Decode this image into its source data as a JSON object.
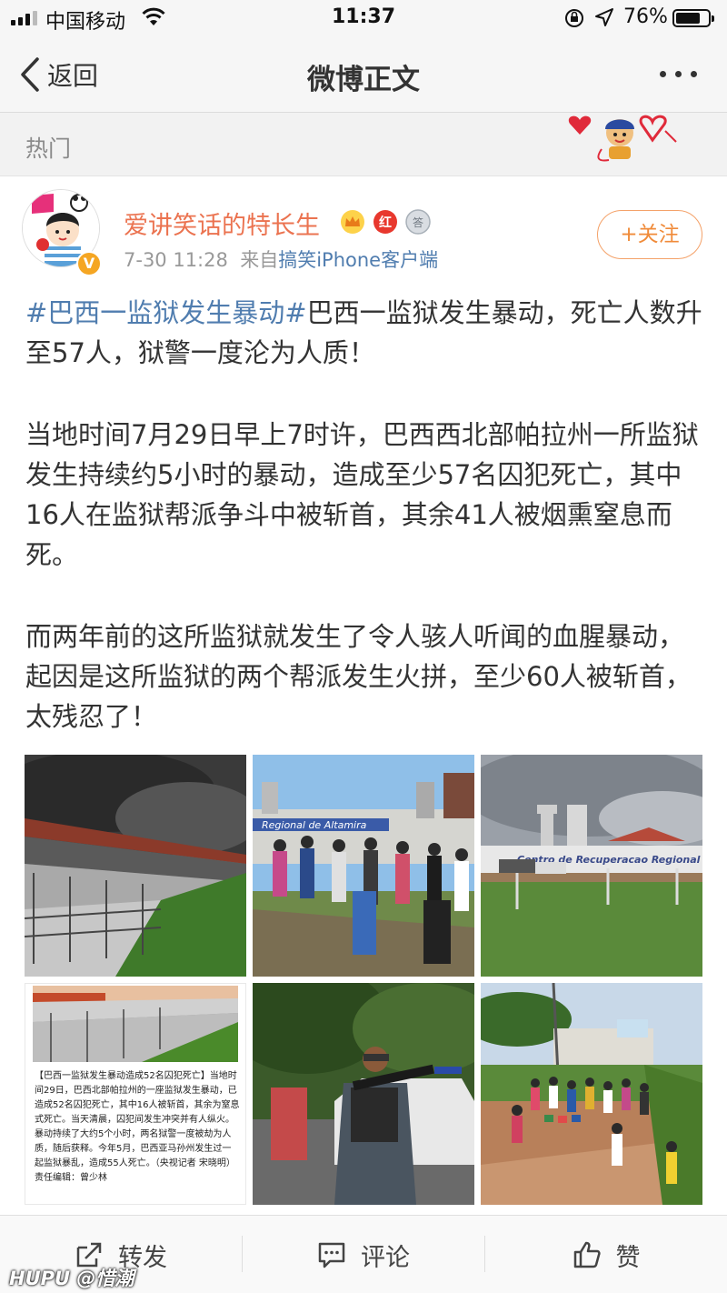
{
  "status_bar": {
    "carrier": "中国移动",
    "time": "11:37",
    "battery_percent": "76%",
    "battery_level": 0.76
  },
  "nav": {
    "back_label": "返回",
    "title": "微博正文",
    "more_icon": "ellipsis-icon"
  },
  "hot": {
    "label": "热门"
  },
  "post": {
    "username": "爱讲笑话的特长生",
    "badges": [
      "crown-icon",
      "red-badge-icon",
      "medal-icon"
    ],
    "badge_red_text": "红",
    "badge_medal_text": "答",
    "verified_mark": "V",
    "date": "7-30 11:28",
    "source_prefix": "来自",
    "source_app": "搞笑iPhone客户端",
    "follow_label": "+关注",
    "topic": "#巴西一监狱发生暴动#",
    "p1_rest": "巴西一监狱发生暴动，死亡人数升至57人，狱警一度沦为人质！",
    "p2": "当地时间7月29日早上7时许，巴西西北部帕拉州一所监狱发生持续约5小时的暴动，造成至少57名囚犯死亡，其中16人在监狱帮派争斗中被斩首，其余41人被烟熏窒息而死。",
    "p3": "而两年前的这所监狱就发生了令人骇人听闻的血腥暴动，起因是这所监狱的两个帮派发生火拼，至少60人被斩首，太残忍了！",
    "images": [
      {
        "name": "smoke over prison"
      },
      {
        "name": "crowd at prison gate",
        "sign": "Regional de Altamira"
      },
      {
        "name": "prison wall with smoke",
        "sign": "Centro de Recuperacao Regional d"
      },
      {
        "name": "news caption card",
        "caption": "【巴西一监狱发生暴动造成52名囚犯死亡】当地时间29日，巴西北部帕拉州的一座监狱发生暴动，已造成52名囚犯死亡，其中16人被斩首，其余为窒息式死亡。当天清晨，囚犯间发生冲突并有人纵火。暴动持续了大约5个小时，两名狱警一度被劫为人质，随后获释。今年5月，巴西亚马孙州发生过一起监狱暴乱，造成55人死亡。（央视记者 宋晓明）责任编辑：曾少林"
      },
      {
        "name": "armed officer"
      },
      {
        "name": "families outside prison"
      }
    ]
  },
  "toolbar": {
    "repost_label": "转发",
    "comment_label": "评论",
    "like_label": "赞"
  },
  "watermark": "HUPU @惜潮",
  "colors": {
    "username": "#eb7350",
    "link": "#507daf",
    "follow": "#f08b3a"
  }
}
